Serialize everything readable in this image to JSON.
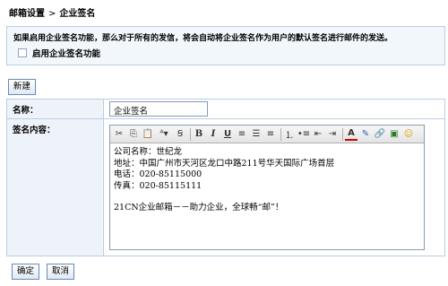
{
  "breadcrumb": {
    "root": "邮箱设置",
    "separator": ">",
    "current": "企业签名"
  },
  "notice": {
    "text": "如果启用企业签名功能，那么对于所有的发信，将会自动将企业签名作为用户的默认签名进行邮件的发送。",
    "checkbox_label": "启用企业签名功能",
    "checked": false
  },
  "new_button": "新建",
  "form": {
    "name_label": "名称：",
    "name_value": "企业签名",
    "content_label": "签名内容：",
    "content_lines": [
      "公司名称：世纪龙",
      "地址：中国广州市天河区龙口中路211号华天国际广场首层",
      "电话：020-85115000",
      "传真：020-85115111",
      "",
      "21CN企业邮箱－－助力企业，全球畅“邮”！"
    ]
  },
  "toolbar_icons": [
    "cut-icon",
    "copy-icon",
    "paste-icon",
    "font-color-dropdown-icon",
    "font-size-icon",
    "bold-icon",
    "italic-icon",
    "underline-icon",
    "align-left-icon",
    "align-center-icon",
    "align-right-icon",
    "ordered-list-icon",
    "unordered-list-icon",
    "outdent-icon",
    "indent-icon",
    "text-color-icon",
    "highlight-icon",
    "link-icon",
    "image-icon",
    "emoticon-icon"
  ],
  "actions": {
    "confirm": "确定",
    "cancel": "取消"
  }
}
